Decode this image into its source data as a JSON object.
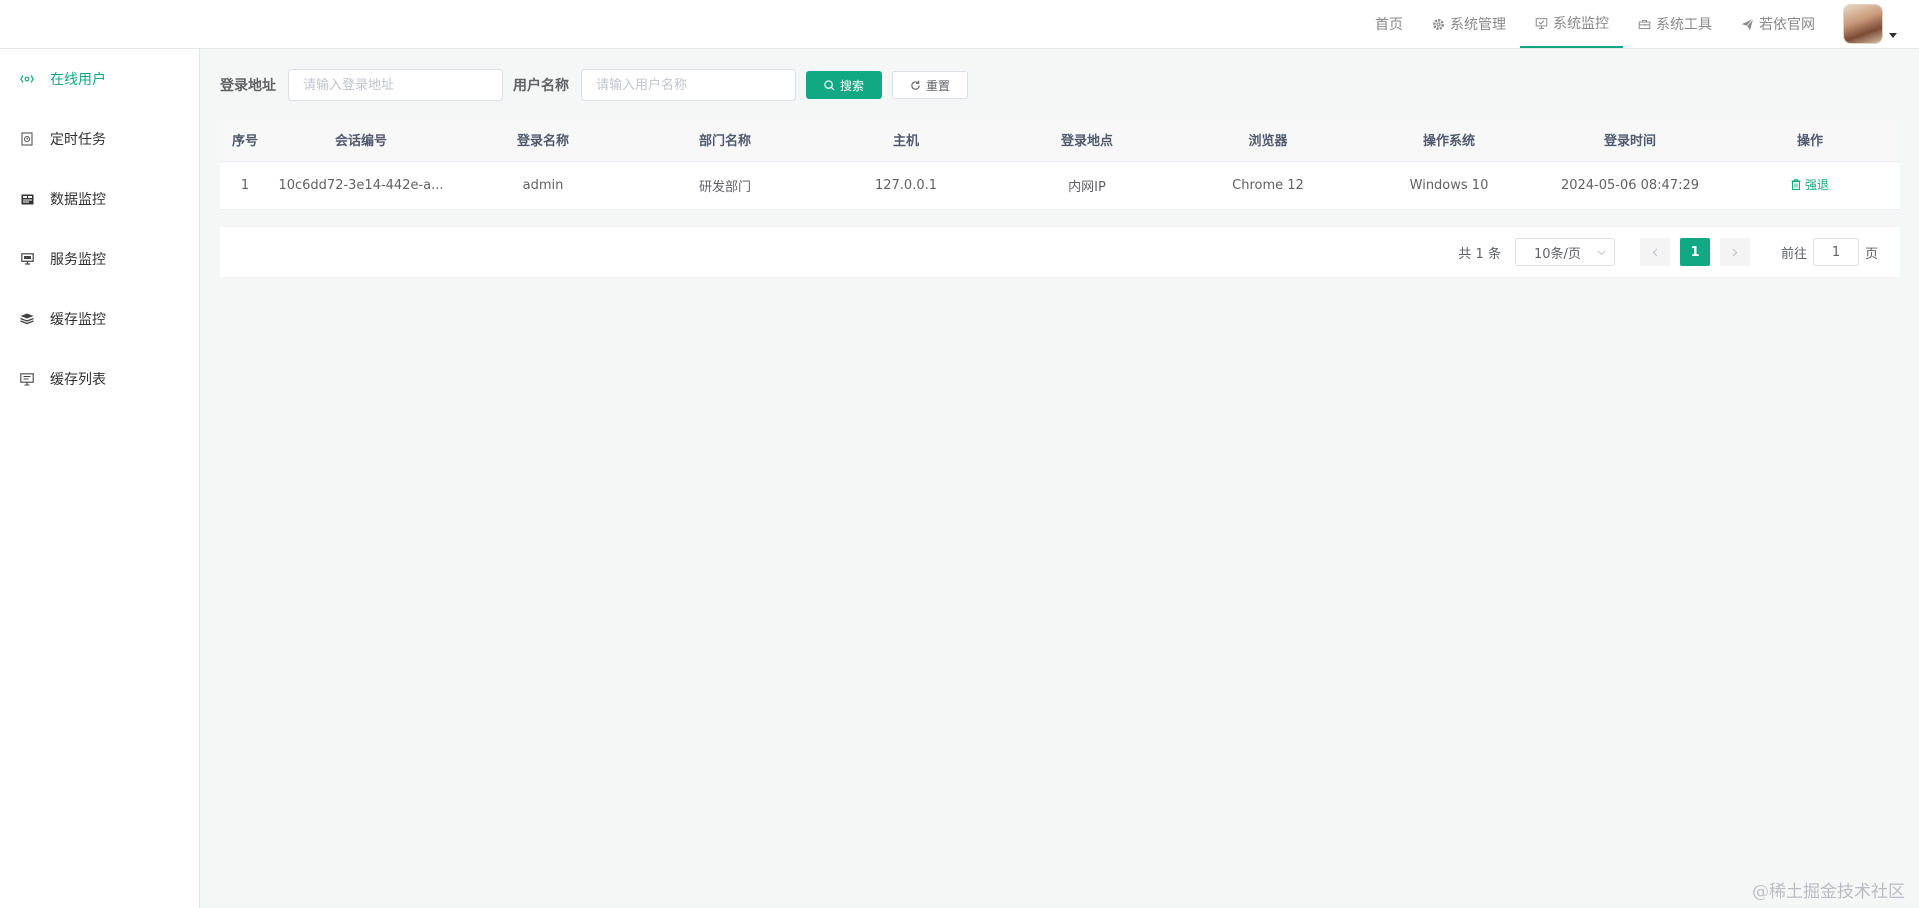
{
  "navbar": {
    "items": [
      {
        "label": "首页",
        "icon": ""
      },
      {
        "label": "系统管理",
        "icon": "gear-icon"
      },
      {
        "label": "系统监控",
        "icon": "monitor-check-icon",
        "active": true
      },
      {
        "label": "系统工具",
        "icon": "toolbox-icon"
      },
      {
        "label": "若依官网",
        "icon": "paper-plane-icon"
      }
    ]
  },
  "sidebar": {
    "items": [
      {
        "label": "在线用户",
        "icon": "online-icon",
        "active": true
      },
      {
        "label": "定时任务",
        "icon": "job-icon"
      },
      {
        "label": "数据监控",
        "icon": "druid-icon"
      },
      {
        "label": "服务监控",
        "icon": "server-icon"
      },
      {
        "label": "缓存监控",
        "icon": "redis-icon"
      },
      {
        "label": "缓存列表",
        "icon": "redis-list-icon"
      }
    ]
  },
  "search": {
    "ipaddr_label": "登录地址",
    "ipaddr_placeholder": "请输入登录地址",
    "username_label": "用户名称",
    "username_placeholder": "请输入用户名称",
    "search_button": "搜索",
    "reset_button": "重置"
  },
  "table": {
    "headers": [
      "序号",
      "会话编号",
      "登录名称",
      "部门名称",
      "主机",
      "登录地点",
      "浏览器",
      "操作系统",
      "登录时间",
      "操作"
    ],
    "rows": [
      {
        "index": "1",
        "token": "10c6dd72-3e14-442e-a...",
        "username": "admin",
        "dept": "研发部门",
        "host": "127.0.0.1",
        "location": "内网IP",
        "browser": "Chrome 12",
        "os": "Windows 10",
        "login_time": "2024-05-06 08:47:29",
        "action": "强退"
      }
    ]
  },
  "pagination": {
    "total": "共 1 条",
    "page_size": "10条/页",
    "current_page": "1",
    "goto_prefix": "前往",
    "goto_value": "1",
    "goto_suffix": "页"
  },
  "watermark": "@稀土掘金技术社区",
  "colors": {
    "accent": "#11a983"
  }
}
